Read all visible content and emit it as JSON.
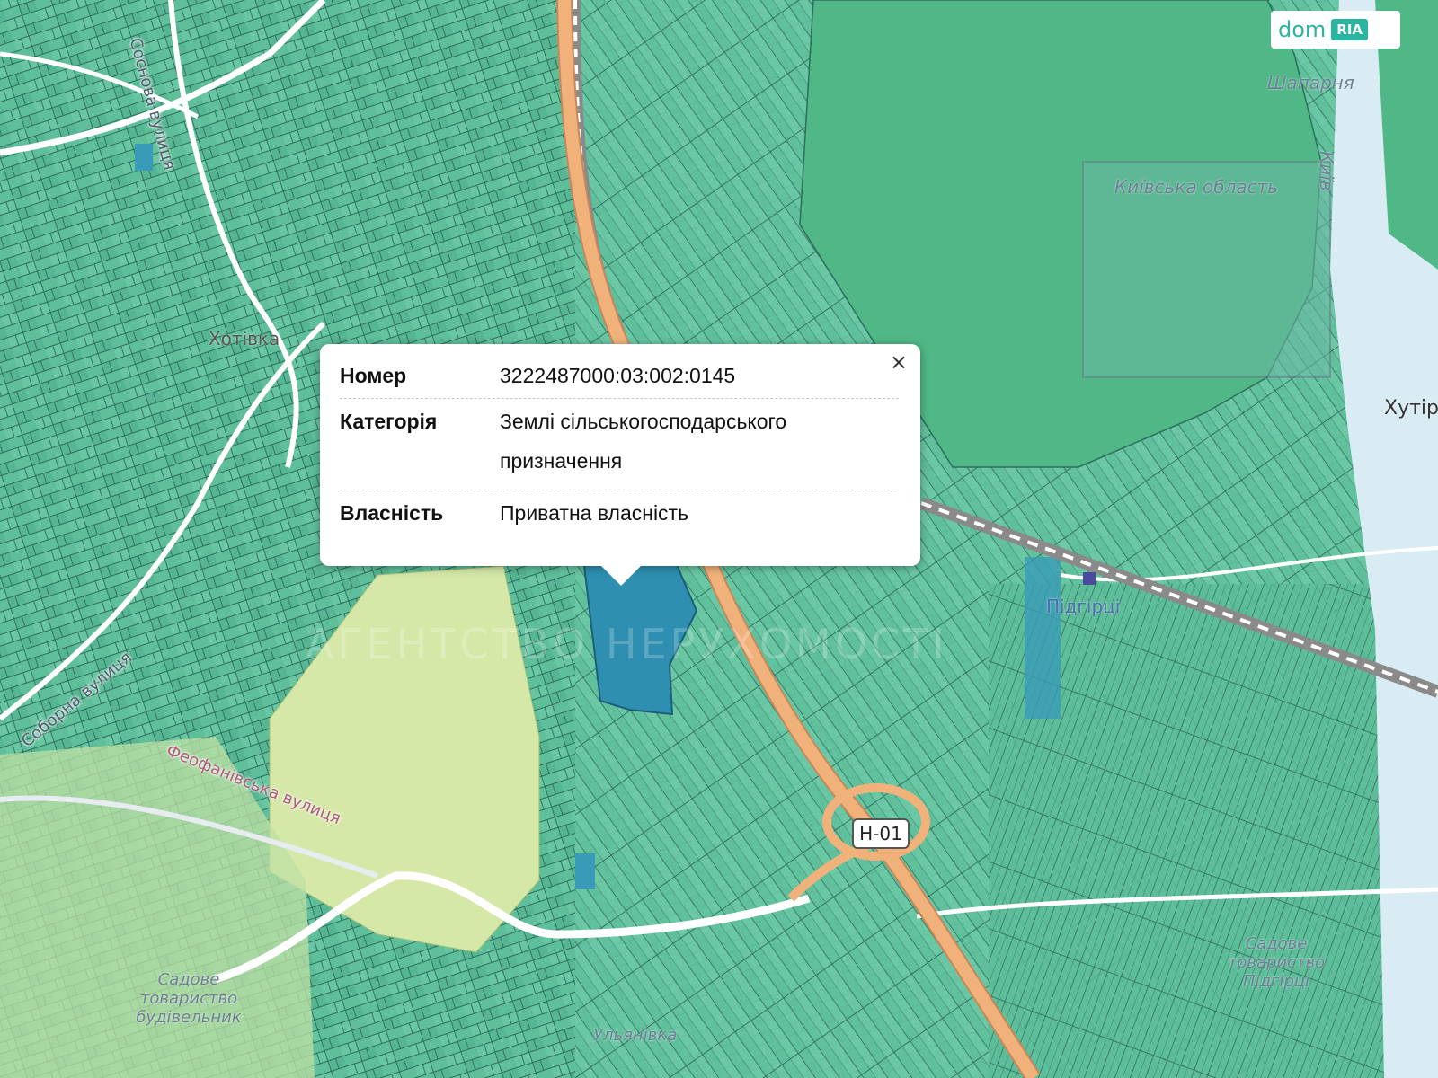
{
  "branding": {
    "logo_text": "dom",
    "logo_badge": "RIA"
  },
  "colors": {
    "parcel_fill": "#5fbf9a",
    "parcel_line": "#2d6e5c",
    "forest": "#4fb886",
    "selected_parcel": "#2e8fb0",
    "highway": "#f0b27a",
    "rail": "#8a8a8a",
    "road": "#ffffff",
    "park": "#d6e8a8"
  },
  "map": {
    "labels": [
      "Шапарня",
      "Київська область",
      "Київ",
      "Хутір",
      "Підгірці",
      "Хотівка",
      "Садове товариство будівельник",
      "Садове товариство Підгірці",
      "Ульянівка"
    ],
    "streets": [
      "Соснова вулиця",
      "Соборна вулиця",
      "Феофанівська вулиця"
    ],
    "road_badge": "Н-01",
    "watermark": "АГЕНТСТВО НЕРУХОМОСТІ"
  },
  "popup": {
    "rows": [
      {
        "key": "Номер",
        "value": "3222487000:03:002:0145"
      },
      {
        "key": "Категорія",
        "value": "Землі сільськогосподарського призначення"
      },
      {
        "key": "Власність",
        "value": "Приватна власність"
      }
    ],
    "close_icon": "close-icon"
  }
}
